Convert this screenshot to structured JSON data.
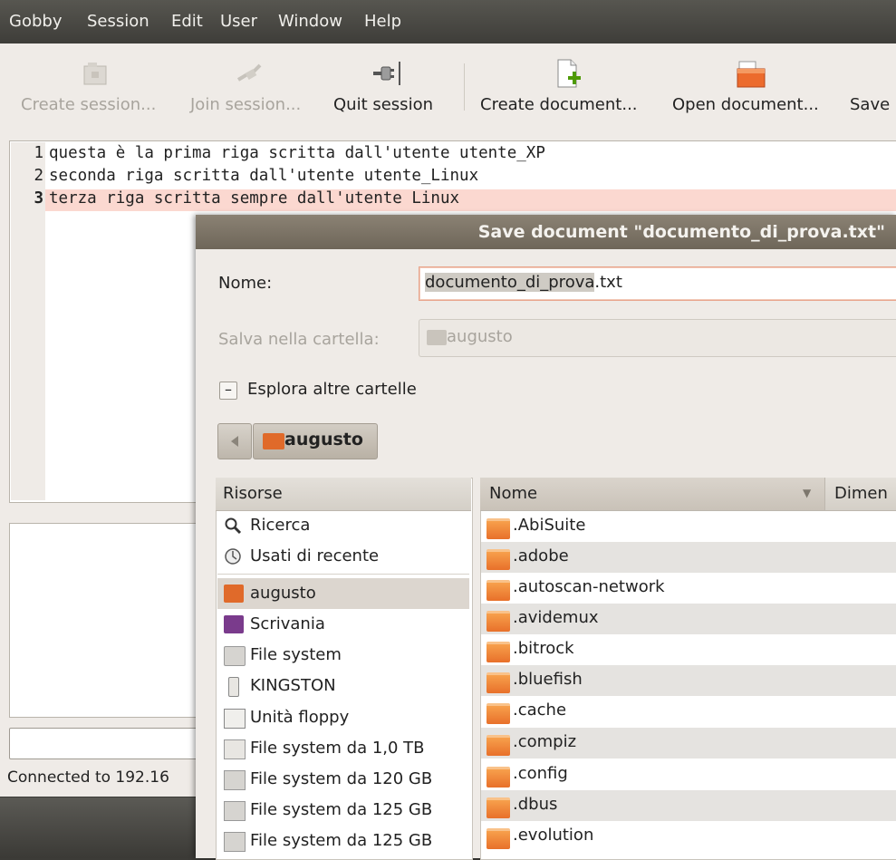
{
  "menubar": {
    "items": [
      "Gobby",
      "Session",
      "Edit",
      "User",
      "Window",
      "Help"
    ]
  },
  "toolbar": {
    "create_session": "Create session...",
    "join_session": "Join session...",
    "quit_session": "Quit session",
    "create_document": "Create document...",
    "open_document": "Open document...",
    "save": "Save"
  },
  "editor": {
    "line_numbers": [
      "1",
      "2",
      "3"
    ],
    "lines": [
      "questa è la prima riga scritta dall'utente utente_XP",
      "seconda riga scritta dall'utente utente_Linux",
      "terza riga scritta sempre dall'utente Linux"
    ],
    "current_line_color": "#fbd8d0"
  },
  "statusbar": {
    "text": "Connected to 192.16"
  },
  "dialog": {
    "title": "Save document \"documento_di_prova.txt\"",
    "name_label": "Nome:",
    "filename_selected": "documento_di_prova",
    "filename_ext": ".txt",
    "folder_label": "Salva nella cartella:",
    "folder_value": "augusto",
    "expander_symbol": "–",
    "expander_label": "Esplora altre cartelle",
    "path_button": "augusto",
    "places_header": "Risorse",
    "places": [
      {
        "label": "Ricerca",
        "icon": "search-icon"
      },
      {
        "label": "Usati di recente",
        "icon": "recent-icon"
      },
      {
        "label": "augusto",
        "icon": "home-folder-icon"
      },
      {
        "label": "Scrivania",
        "icon": "desktop-icon"
      },
      {
        "label": "File system",
        "icon": "drive-icon"
      },
      {
        "label": "KINGSTON",
        "icon": "usb-icon"
      },
      {
        "label": "Unità floppy",
        "icon": "floppy-icon"
      },
      {
        "label": "File system da 1,0 TB",
        "icon": "network-drive-icon"
      },
      {
        "label": "File system da 120 GB",
        "icon": "drive-icon"
      },
      {
        "label": "File system da 125 GB",
        "icon": "drive-icon"
      },
      {
        "label": "File system da 125 GB",
        "icon": "drive-icon"
      }
    ],
    "files_header_name": "Nome",
    "files_header_size": "Dimen",
    "sort_indicator": "▼",
    "files": [
      ".AbiSuite",
      ".adobe",
      ".autoscan-network",
      ".avidemux",
      ".bitrock",
      ".bluefish",
      ".cache",
      ".compiz",
      ".config",
      ".dbus",
      ".evolution"
    ]
  }
}
